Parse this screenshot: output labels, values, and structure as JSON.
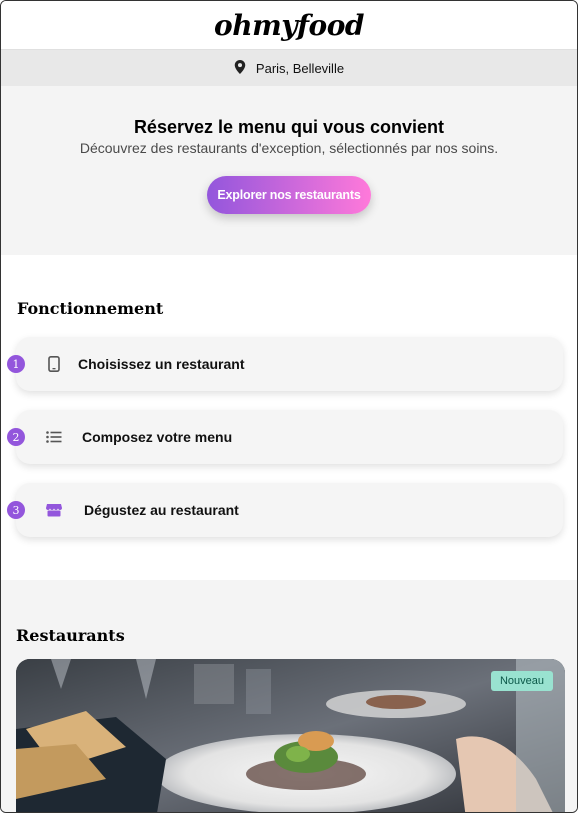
{
  "header": {
    "logo": "ohmyfood"
  },
  "location": {
    "icon": "map-pin-icon",
    "text": "Paris, Belleville"
  },
  "hero": {
    "title": "Réservez le menu qui vous convient",
    "subtitle": "Découvrez des restaurants d'exception, sélectionnés par nos soins.",
    "cta_label": "Explorer nos restaurants"
  },
  "how": {
    "title": "Fonctionnement",
    "steps": [
      {
        "number": "1",
        "icon": "smartphone-icon",
        "label": "Choisissez un restaurant"
      },
      {
        "number": "2",
        "icon": "list-icon",
        "label": "Composez votre menu"
      },
      {
        "number": "3",
        "icon": "store-icon",
        "label": "Dégustez au restaurant"
      }
    ]
  },
  "restaurants": {
    "title": "Restaurants",
    "cards": [
      {
        "badge": "Nouveau"
      }
    ]
  },
  "colors": {
    "accent_start": "#9356dc",
    "accent_end": "#ff79da",
    "badge_bg": "#99e2d0"
  }
}
